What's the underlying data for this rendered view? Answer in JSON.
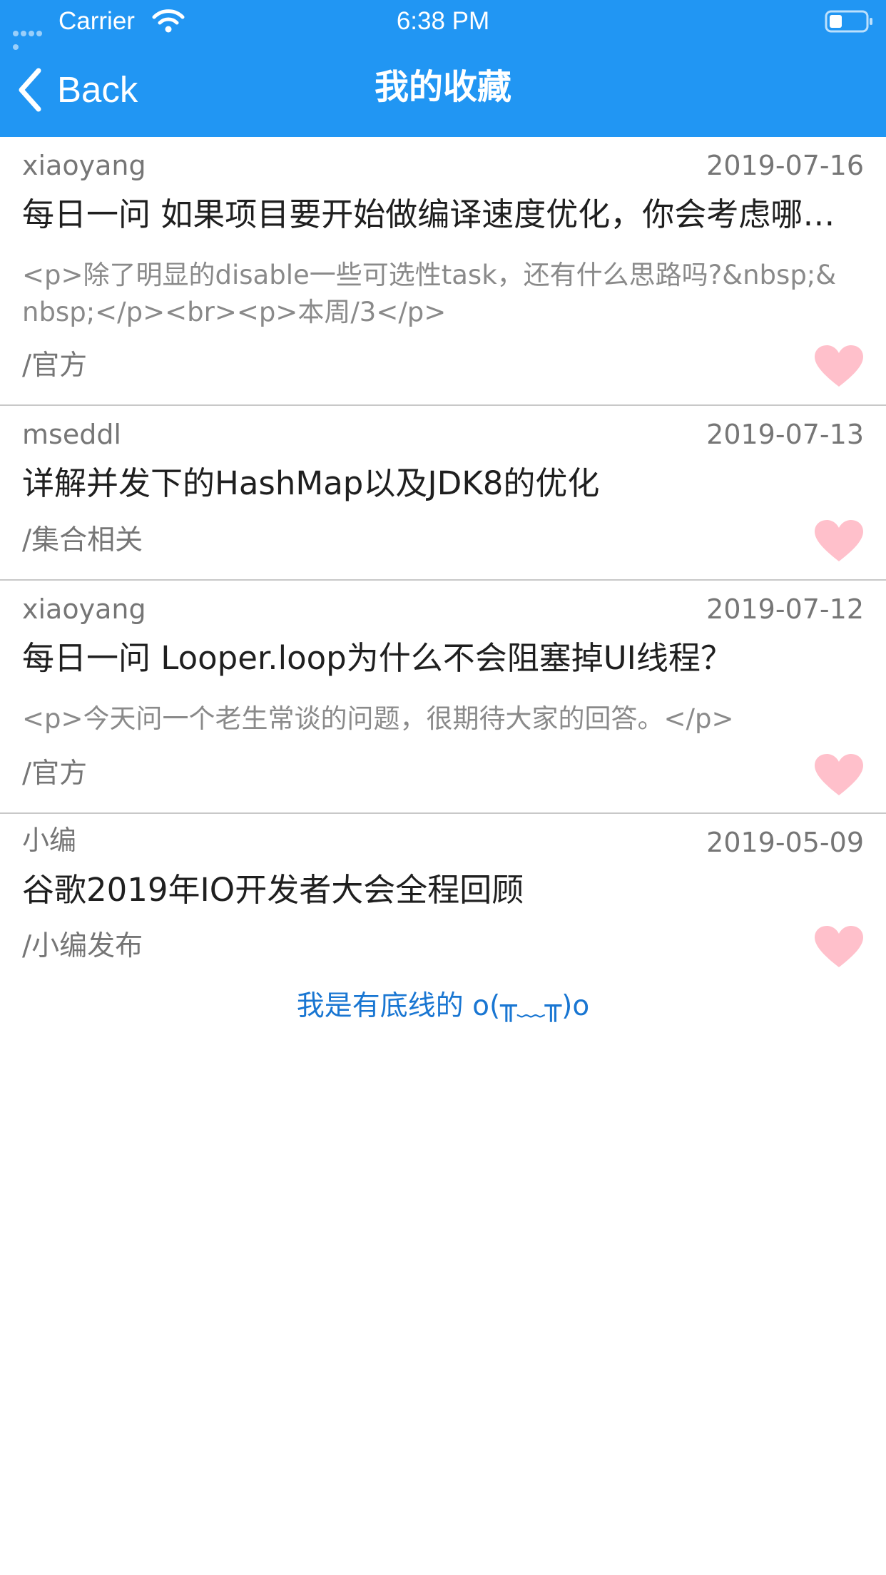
{
  "status_bar": {
    "carrier": "Carrier",
    "time": "6:38 PM",
    "signal_icon": "signal-dots-icon",
    "wifi_icon": "wifi-icon",
    "battery_icon": "battery-icon"
  },
  "nav": {
    "back_label": "Back",
    "title": "我的收藏"
  },
  "colors": {
    "header_bg": "#2196F3",
    "heart": "#FFC0CB",
    "footer_text": "#1976D2",
    "divider": "#C8C8C8"
  },
  "items": [
    {
      "author": "xiaoyang",
      "date": "2019-07-16",
      "title": "每日一问 如果项目要开始做编译速度优化，你会考虑哪些方面呢？",
      "desc": "<p>除了明显的disable一些可选性task，还有什么思路吗?&nbsp;&nbsp;</p><br><p>本周/3</p>",
      "category": "/官方",
      "favorite_icon": "heart-icon"
    },
    {
      "author": "mseddl",
      "date": "2019-07-13",
      "title": "详解并发下的HashMap以及JDK8的优化",
      "desc": "",
      "category": "/集合相关",
      "favorite_icon": "heart-icon"
    },
    {
      "author": "xiaoyang",
      "date": "2019-07-12",
      "title": "每日一问 Looper.loop为什么不会阻塞掉UI线程？",
      "desc": "<p>今天问一个老生常谈的问题，很期待大家的回答。</p>",
      "category": "/官方",
      "favorite_icon": "heart-icon"
    },
    {
      "author": "小编",
      "date": "2019-05-09",
      "title": "谷歌2019年IO开发者大会全程回顾",
      "desc": "",
      "category": "/小编发布",
      "favorite_icon": "heart-icon"
    }
  ],
  "footer": {
    "text": "我是有底线的 o(╥﹏╥)o"
  }
}
